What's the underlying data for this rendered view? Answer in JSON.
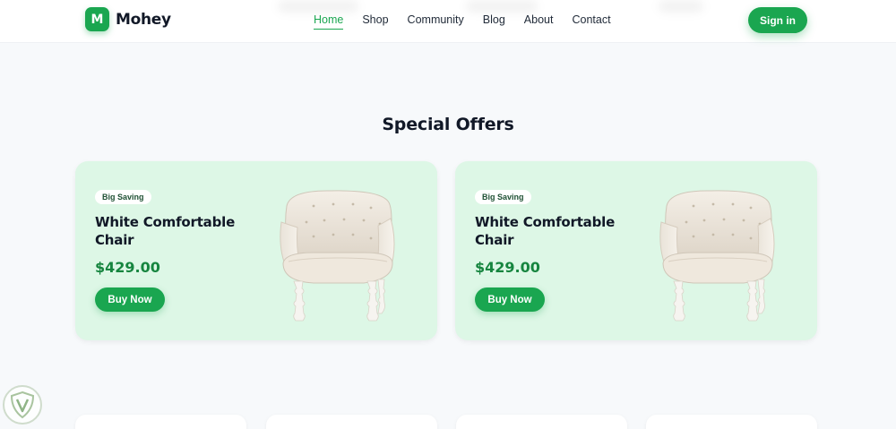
{
  "header": {
    "logo_letter": "M",
    "logo_text": "Mohey",
    "nav": [
      {
        "label": "Home",
        "active": true
      },
      {
        "label": "Shop",
        "active": false
      },
      {
        "label": "Community",
        "active": false
      },
      {
        "label": "Blog",
        "active": false
      },
      {
        "label": "About",
        "active": false
      },
      {
        "label": "Contact",
        "active": false
      }
    ],
    "signin_label": "Sign in"
  },
  "section": {
    "title": "Special Offers",
    "offers": [
      {
        "badge": "Big Saving",
        "title": "White Comfortable Chair",
        "price": "$429.00",
        "button": "Buy Now",
        "image_icon": "armchair-image"
      },
      {
        "badge": "Big Saving",
        "title": "White Comfortable Chair",
        "price": "$429.00",
        "button": "Buy Now",
        "image_icon": "armchair-image"
      }
    ]
  },
  "colors": {
    "accent": "#1aa650",
    "price": "#16853f",
    "card_bg": "#ddf7e6",
    "page_bg": "#f7f9fb"
  }
}
